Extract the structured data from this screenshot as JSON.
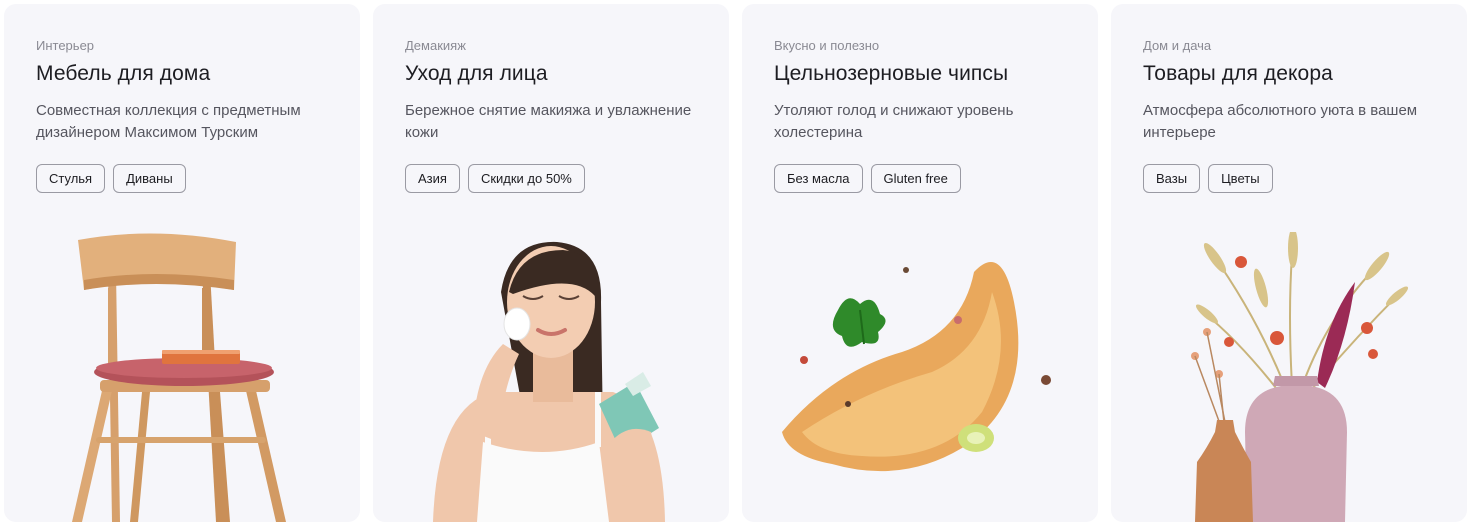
{
  "cards": [
    {
      "category": "Интерьер",
      "title": "Мебель для дома",
      "description": "Совместная коллекция с предметным дизайнером Максимом Турским",
      "tags": [
        "Стулья",
        "Диваны"
      ],
      "image": "wooden-chair"
    },
    {
      "category": "Демакияж",
      "title": "Уход для лица",
      "description": "Бережное снятие макияжа и увлажнение кожи",
      "tags": [
        "Азия",
        "Скидки до 50%"
      ],
      "image": "woman-with-cotton-pad"
    },
    {
      "category": "Вкусно и полезно",
      "title": "Цельнозерновые чипсы",
      "description": "Утоляют голод и снижают уровень холестерина",
      "tags": [
        "Без масла",
        "Gluten free"
      ],
      "image": "potato-chip"
    },
    {
      "category": "Дом и дача",
      "title": "Товары для декора",
      "description": "Атмосфера абсолютного уюта в вашем интерьере",
      "tags": [
        "Вазы",
        "Цветы"
      ],
      "image": "vases-with-dried-flowers"
    }
  ]
}
